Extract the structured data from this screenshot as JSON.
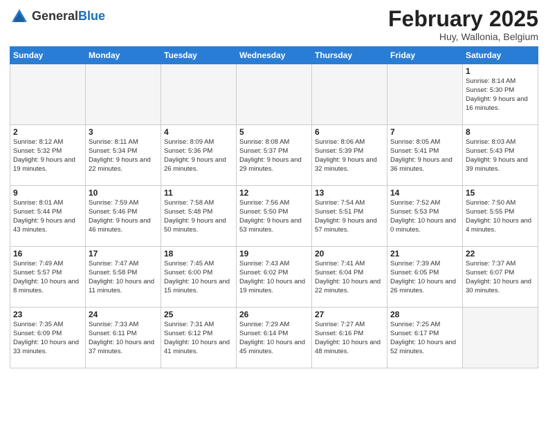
{
  "header": {
    "logo_general": "General",
    "logo_blue": "Blue",
    "title": "February 2025",
    "subtitle": "Huy, Wallonia, Belgium"
  },
  "weekdays": [
    "Sunday",
    "Monday",
    "Tuesday",
    "Wednesday",
    "Thursday",
    "Friday",
    "Saturday"
  ],
  "weeks": [
    [
      {
        "day": "",
        "info": ""
      },
      {
        "day": "",
        "info": ""
      },
      {
        "day": "",
        "info": ""
      },
      {
        "day": "",
        "info": ""
      },
      {
        "day": "",
        "info": ""
      },
      {
        "day": "",
        "info": ""
      },
      {
        "day": "1",
        "info": "Sunrise: 8:14 AM\nSunset: 5:30 PM\nDaylight: 9 hours and 16 minutes."
      }
    ],
    [
      {
        "day": "2",
        "info": "Sunrise: 8:12 AM\nSunset: 5:32 PM\nDaylight: 9 hours and 19 minutes."
      },
      {
        "day": "3",
        "info": "Sunrise: 8:11 AM\nSunset: 5:34 PM\nDaylight: 9 hours and 22 minutes."
      },
      {
        "day": "4",
        "info": "Sunrise: 8:09 AM\nSunset: 5:36 PM\nDaylight: 9 hours and 26 minutes."
      },
      {
        "day": "5",
        "info": "Sunrise: 8:08 AM\nSunset: 5:37 PM\nDaylight: 9 hours and 29 minutes."
      },
      {
        "day": "6",
        "info": "Sunrise: 8:06 AM\nSunset: 5:39 PM\nDaylight: 9 hours and 32 minutes."
      },
      {
        "day": "7",
        "info": "Sunrise: 8:05 AM\nSunset: 5:41 PM\nDaylight: 9 hours and 36 minutes."
      },
      {
        "day": "8",
        "info": "Sunrise: 8:03 AM\nSunset: 5:43 PM\nDaylight: 9 hours and 39 minutes."
      }
    ],
    [
      {
        "day": "9",
        "info": "Sunrise: 8:01 AM\nSunset: 5:44 PM\nDaylight: 9 hours and 43 minutes."
      },
      {
        "day": "10",
        "info": "Sunrise: 7:59 AM\nSunset: 5:46 PM\nDaylight: 9 hours and 46 minutes."
      },
      {
        "day": "11",
        "info": "Sunrise: 7:58 AM\nSunset: 5:48 PM\nDaylight: 9 hours and 50 minutes."
      },
      {
        "day": "12",
        "info": "Sunrise: 7:56 AM\nSunset: 5:50 PM\nDaylight: 9 hours and 53 minutes."
      },
      {
        "day": "13",
        "info": "Sunrise: 7:54 AM\nSunset: 5:51 PM\nDaylight: 9 hours and 57 minutes."
      },
      {
        "day": "14",
        "info": "Sunrise: 7:52 AM\nSunset: 5:53 PM\nDaylight: 10 hours and 0 minutes."
      },
      {
        "day": "15",
        "info": "Sunrise: 7:50 AM\nSunset: 5:55 PM\nDaylight: 10 hours and 4 minutes."
      }
    ],
    [
      {
        "day": "16",
        "info": "Sunrise: 7:49 AM\nSunset: 5:57 PM\nDaylight: 10 hours and 8 minutes."
      },
      {
        "day": "17",
        "info": "Sunrise: 7:47 AM\nSunset: 5:58 PM\nDaylight: 10 hours and 11 minutes."
      },
      {
        "day": "18",
        "info": "Sunrise: 7:45 AM\nSunset: 6:00 PM\nDaylight: 10 hours and 15 minutes."
      },
      {
        "day": "19",
        "info": "Sunrise: 7:43 AM\nSunset: 6:02 PM\nDaylight: 10 hours and 19 minutes."
      },
      {
        "day": "20",
        "info": "Sunrise: 7:41 AM\nSunset: 6:04 PM\nDaylight: 10 hours and 22 minutes."
      },
      {
        "day": "21",
        "info": "Sunrise: 7:39 AM\nSunset: 6:05 PM\nDaylight: 10 hours and 26 minutes."
      },
      {
        "day": "22",
        "info": "Sunrise: 7:37 AM\nSunset: 6:07 PM\nDaylight: 10 hours and 30 minutes."
      }
    ],
    [
      {
        "day": "23",
        "info": "Sunrise: 7:35 AM\nSunset: 6:09 PM\nDaylight: 10 hours and 33 minutes."
      },
      {
        "day": "24",
        "info": "Sunrise: 7:33 AM\nSunset: 6:11 PM\nDaylight: 10 hours and 37 minutes."
      },
      {
        "day": "25",
        "info": "Sunrise: 7:31 AM\nSunset: 6:12 PM\nDaylight: 10 hours and 41 minutes."
      },
      {
        "day": "26",
        "info": "Sunrise: 7:29 AM\nSunset: 6:14 PM\nDaylight: 10 hours and 45 minutes."
      },
      {
        "day": "27",
        "info": "Sunrise: 7:27 AM\nSunset: 6:16 PM\nDaylight: 10 hours and 48 minutes."
      },
      {
        "day": "28",
        "info": "Sunrise: 7:25 AM\nSunset: 6:17 PM\nDaylight: 10 hours and 52 minutes."
      },
      {
        "day": "",
        "info": ""
      }
    ]
  ]
}
